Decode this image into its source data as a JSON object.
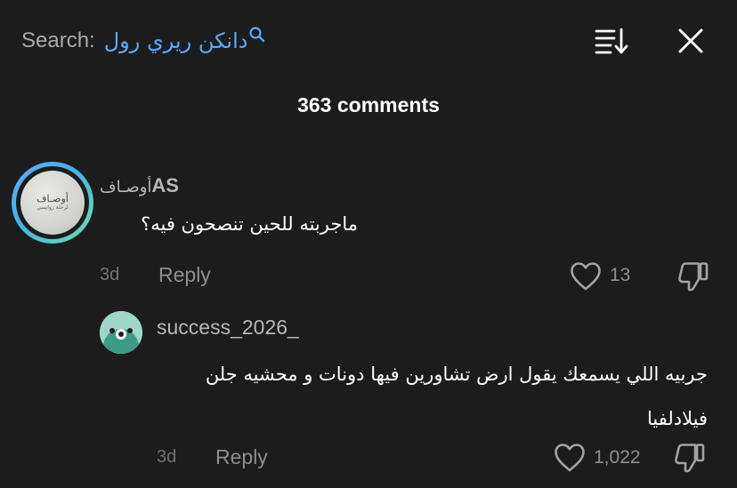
{
  "search": {
    "label": "Search:",
    "query": "دانكن ريري رول"
  },
  "header": {
    "comment_count": "363 comments"
  },
  "colors": {
    "accent": "#5aa9f7",
    "background": "#1c1c1d",
    "secondary_text": "#8e8e91"
  },
  "icons": {
    "search": "search-icon",
    "sort": "sort-icon",
    "close": "close-icon",
    "like": "heart-icon",
    "dislike": "thumbs-down-icon"
  },
  "comments": [
    {
      "username_latin": "AS",
      "username_arabic": "أوصـاف",
      "avatar_logo_text": "أوصـاف",
      "avatar_logo_subtext": "لرحلة زوايسي",
      "text": "ماجربته للحين تنصحون فيه؟",
      "time": "3d",
      "reply_label": "Reply",
      "likes": "13"
    },
    {
      "username": "success_2026_",
      "text": "جربيه اللي يسمعك يقول ارض تشاورين فيها دونات و محشيه جلن فيلادلفيا",
      "time": "3d",
      "reply_label": "Reply",
      "likes": "1,022"
    }
  ]
}
